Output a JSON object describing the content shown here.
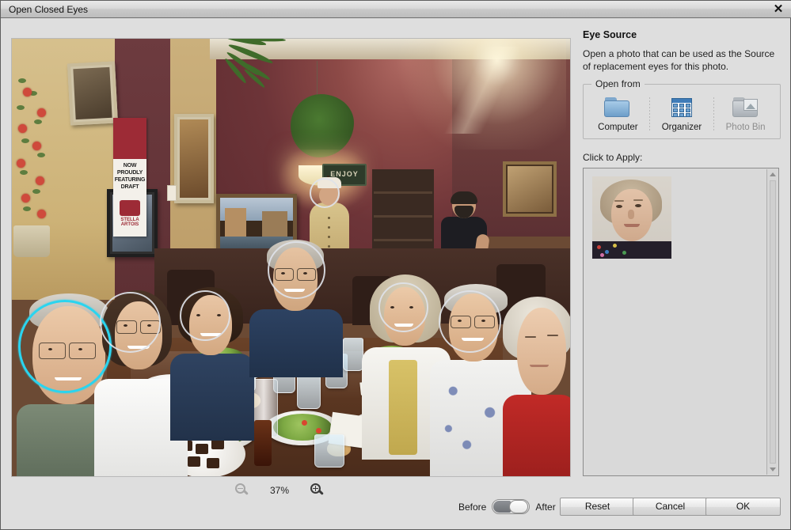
{
  "window": {
    "title": "Open Closed Eyes",
    "close_icon": "close-icon"
  },
  "canvas": {
    "zoom_level": "37%",
    "zoom_out_icon": "zoom-out-icon",
    "zoom_in_icon": "zoom-in-icon",
    "photo_description": "Group of eight people seated around a restaurant table with salads, bread rolls and drinks; face-detection circles overlay each detected face, the left-most man's face is selected with a cyan circle."
  },
  "eye_source": {
    "heading": "Eye Source",
    "description": "Open a photo that can be used as the Source of replacement eyes for this photo.",
    "open_from": {
      "legend": "Open from",
      "items": [
        {
          "label": "Computer",
          "icon": "folder-icon",
          "disabled": false
        },
        {
          "label": "Organizer",
          "icon": "grid-table-icon",
          "disabled": false
        },
        {
          "label": "Photo Bin",
          "icon": "photo-folder-icon",
          "disabled": true
        }
      ]
    },
    "apply": {
      "label": "Click to Apply:",
      "thumbnails": [
        {
          "alt": "Portrait of an older woman with curly blonde-grey hair wearing a dark floral top"
        }
      ]
    }
  },
  "footer": {
    "before_label": "Before",
    "after_label": "After",
    "toggle_state": "after",
    "buttons": [
      {
        "name": "reset",
        "label": "Reset"
      },
      {
        "name": "cancel",
        "label": "Cancel"
      },
      {
        "name": "ok",
        "label": "OK"
      }
    ]
  },
  "colors": {
    "dialog_background": "#dedede",
    "selected_face_circle": "#2ad4ef",
    "idle_face_circle": "#dee2e8",
    "accent_blue": "#3f7cb8"
  },
  "photo_signage": {
    "banner_lines": "NOW PROUDLY FEATURING DRAFT",
    "banner_brand": "STELLA ARTOIS",
    "wall_sign": "ENJOY"
  }
}
